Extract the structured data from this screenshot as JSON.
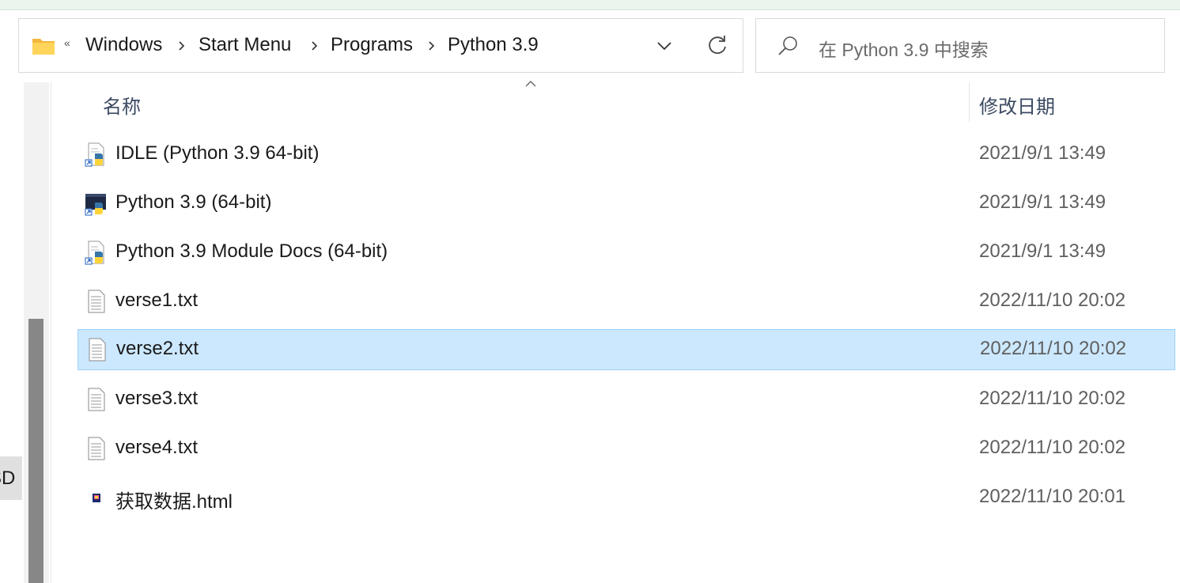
{
  "address_bar": {
    "overflow_glyph": "«",
    "crumbs": [
      "Windows",
      "Start Menu",
      "Programs",
      "Python 3.9"
    ]
  },
  "search": {
    "placeholder": "在 Python 3.9 中搜索"
  },
  "nav_pane": {
    "partial_item_label": "SD"
  },
  "columns": {
    "name": "名称",
    "date_modified": "修改日期",
    "sort_column": "name"
  },
  "files": [
    {
      "name": "IDLE (Python 3.9 64-bit)",
      "date": "2021/9/1 13:49",
      "icon": "python-shortcut-icon",
      "selected": false
    },
    {
      "name": "Python 3.9 (64-bit)",
      "date": "2021/9/1 13:49",
      "icon": "python-console-shortcut-icon",
      "selected": false
    },
    {
      "name": "Python 3.9 Module Docs (64-bit)",
      "date": "2021/9/1 13:49",
      "icon": "python-shortcut-icon",
      "selected": false
    },
    {
      "name": "verse1.txt",
      "date": "2022/11/10 20:02",
      "icon": "text-file-icon",
      "selected": false
    },
    {
      "name": "verse2.txt",
      "date": "2022/11/10 20:02",
      "icon": "text-file-icon",
      "selected": true
    },
    {
      "name": "verse3.txt",
      "date": "2022/11/10 20:02",
      "icon": "text-file-icon",
      "selected": false
    },
    {
      "name": "verse4.txt",
      "date": "2022/11/10 20:02",
      "icon": "text-file-icon",
      "selected": false
    },
    {
      "name": "获取数据.html",
      "date": "2022/11/10 20:01",
      "icon": "html-file-icon",
      "selected": false
    }
  ],
  "colors": {
    "selection_fill": "#cce8ff",
    "selection_border": "#99d1ff",
    "folder_yellow": "#ffc83d",
    "python_blue": "#3776ab",
    "python_yellow": "#ffd43b"
  }
}
